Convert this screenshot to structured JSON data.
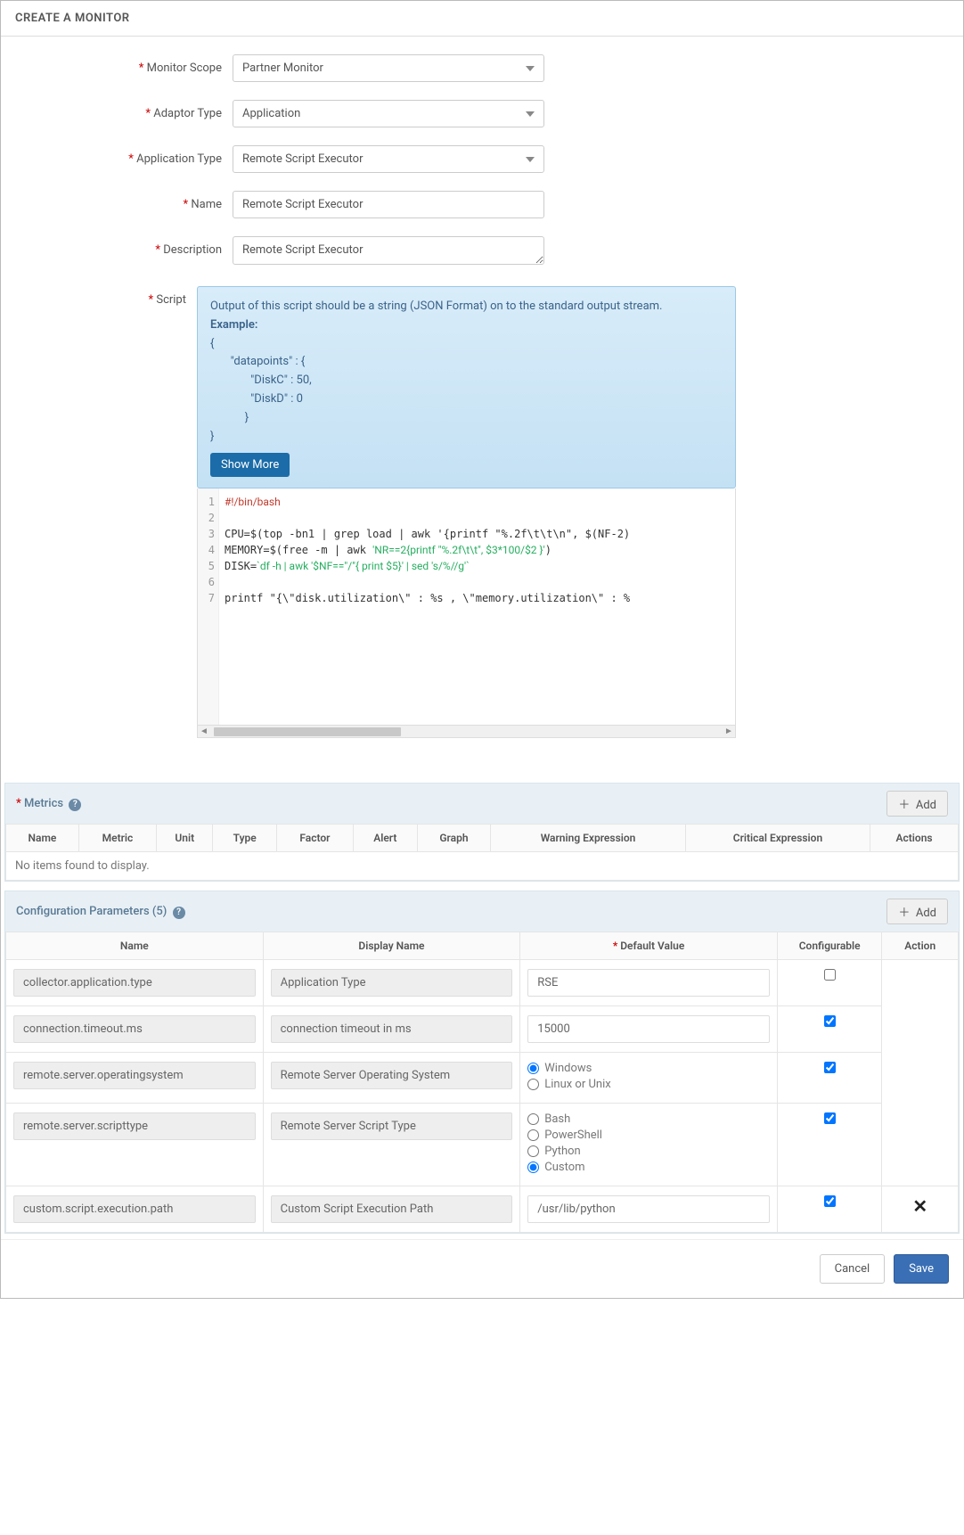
{
  "header": {
    "title": "CREATE A MONITOR"
  },
  "form": {
    "monitorScope": {
      "label": "Monitor Scope",
      "value": "Partner Monitor"
    },
    "adaptorType": {
      "label": "Adaptor Type",
      "value": "Application"
    },
    "applicationType": {
      "label": "Application Type",
      "value": "Remote Script Executor"
    },
    "name": {
      "label": "Name",
      "value": "Remote Script Executor"
    },
    "description": {
      "label": "Description",
      "value": "Remote Script Executor"
    },
    "script": {
      "label": "Script",
      "hint": {
        "line1": "Output of this script should be a string (JSON Format) on to the standard output stream.",
        "example_label": "Example:",
        "example_body": "{\n       \"datapoints\" : {\n              \"DiskC\" : 50,\n              \"DiskD\" : 0\n            }\n}"
      },
      "showMore": "Show More",
      "code": {
        "lines": [
          "#!/bin/bash",
          "",
          "CPU=$(top -bn1 | grep load | awk '{printf \"%.2f\\t\\t\\n\", $(NF-2)",
          "MEMORY=$(free -m | awk 'NR==2{printf \"%.2f\\t\\t\", $3*100/$2 }')",
          "DISK=`df -h | awk '$NF==\"/\"{ print $5}' | sed 's/%//g'`",
          "",
          "printf \"{\\\"disk.utilization\\\" : %s , \\\"memory.utilization\\\" : %"
        ]
      }
    }
  },
  "metrics": {
    "title": "Metrics",
    "addLabel": "Add",
    "columns": [
      "Name",
      "Metric",
      "Unit",
      "Type",
      "Factor",
      "Alert",
      "Graph",
      "Warning Expression",
      "Critical Expression",
      "Actions"
    ],
    "empty": "No items found to display."
  },
  "config": {
    "title": "Configuration Parameters (5)",
    "addLabel": "Add",
    "columns": {
      "name": "Name",
      "display": "Display Name",
      "default": "Default Value",
      "configurable": "Configurable",
      "action": "Action"
    },
    "rows": [
      {
        "name": "collector.application.type",
        "display": "Application Type",
        "value": {
          "type": "text",
          "val": "RSE"
        },
        "configurable": false,
        "deletable": false
      },
      {
        "name": "connection.timeout.ms",
        "display": "connection timeout in ms",
        "value": {
          "type": "text",
          "val": "15000"
        },
        "configurable": true,
        "deletable": false
      },
      {
        "name": "remote.server.operatingsystem",
        "display": "Remote Server Operating System",
        "value": {
          "type": "radio",
          "options": [
            "Windows",
            "Linux or Unix"
          ],
          "selected": "Windows"
        },
        "configurable": true,
        "deletable": false
      },
      {
        "name": "remote.server.scripttype",
        "display": "Remote Server Script Type",
        "value": {
          "type": "radio",
          "options": [
            "Bash",
            "PowerShell",
            "Python",
            "Custom"
          ],
          "selected": "Custom"
        },
        "configurable": true,
        "deletable": false
      },
      {
        "name": "custom.script.execution.path",
        "display": "Custom Script Execution Path",
        "value": {
          "type": "text",
          "val": "/usr/lib/python"
        },
        "configurable": true,
        "deletable": true
      }
    ]
  },
  "footer": {
    "cancel": "Cancel",
    "save": "Save"
  },
  "glyphs": {
    "plus": "＋",
    "close": "✕"
  }
}
